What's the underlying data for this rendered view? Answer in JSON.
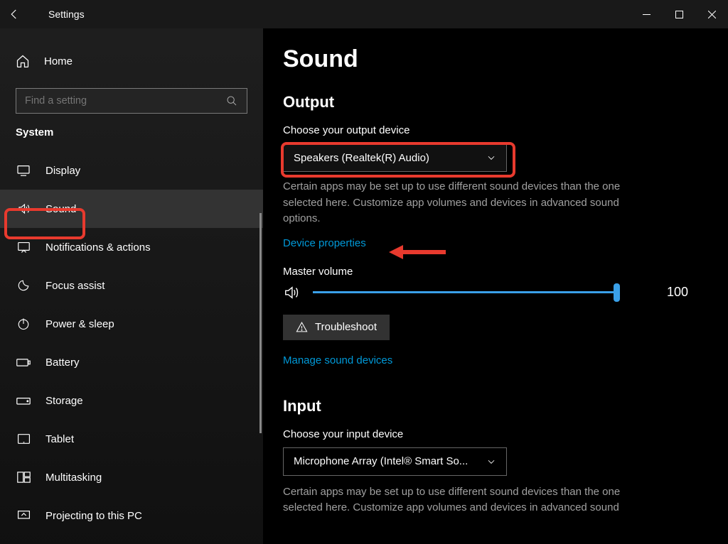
{
  "titlebar": {
    "title": "Settings"
  },
  "sidebar": {
    "home": "Home",
    "search_placeholder": "Find a setting",
    "section": "System",
    "items": [
      {
        "label": "Display"
      },
      {
        "label": "Sound"
      },
      {
        "label": "Notifications & actions"
      },
      {
        "label": "Focus assist"
      },
      {
        "label": "Power & sleep"
      },
      {
        "label": "Battery"
      },
      {
        "label": "Storage"
      },
      {
        "label": "Tablet"
      },
      {
        "label": "Multitasking"
      },
      {
        "label": "Projecting to this PC"
      }
    ]
  },
  "main": {
    "page_title": "Sound",
    "output": {
      "heading": "Output",
      "choose_label": "Choose your output device",
      "device": "Speakers (Realtek(R) Audio)",
      "desc": "Certain apps may be set up to use different sound devices than the one selected here. Customize app volumes and devices in advanced sound options.",
      "device_properties": "Device properties",
      "master_label": "Master volume",
      "volume": "100",
      "troubleshoot": "Troubleshoot",
      "manage": "Manage sound devices"
    },
    "input": {
      "heading": "Input",
      "choose_label": "Choose your input device",
      "device": "Microphone Array (Intel® Smart So...",
      "desc": "Certain apps may be set up to use different sound devices than the one selected here. Customize app volumes and devices in advanced sound"
    }
  }
}
